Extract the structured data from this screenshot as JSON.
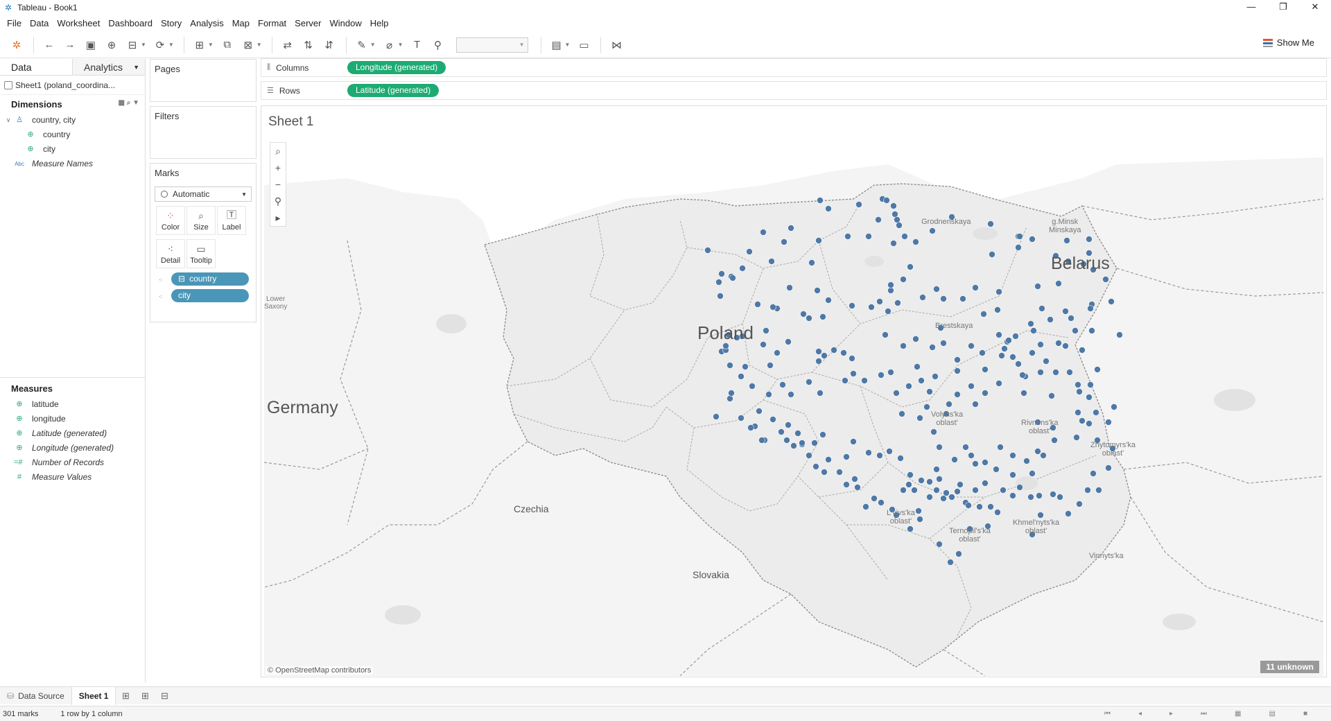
{
  "window": {
    "title": "Tableau - Book1",
    "controls": [
      "—",
      "❐",
      "✕"
    ]
  },
  "menu": [
    "File",
    "Data",
    "Worksheet",
    "Dashboard",
    "Story",
    "Analysis",
    "Map",
    "Format",
    "Server",
    "Window",
    "Help"
  ],
  "toolbar": {
    "show_me_label": "Show Me"
  },
  "data_pane": {
    "tab_data": "Data",
    "tab_analytics": "Analytics",
    "datasource": "Sheet1 (poland_coordina...",
    "dimensions_title": "Dimensions",
    "dimensions": [
      {
        "label": "country, city",
        "icon": "hierarchy-icon"
      },
      {
        "label": "country",
        "icon": "globe-icon"
      },
      {
        "label": "city",
        "icon": "globe-icon"
      },
      {
        "label": "Measure Names",
        "icon": "abc-icon"
      }
    ],
    "measures_title": "Measures",
    "measures": [
      {
        "label": "latitude",
        "icon": "globe-icon"
      },
      {
        "label": "longitude",
        "icon": "globe-icon"
      },
      {
        "label": "Latitude (generated)",
        "icon": "globe-icon"
      },
      {
        "label": "Longitude (generated)",
        "icon": "globe-icon"
      },
      {
        "label": "Number of Records",
        "icon": "hash-icon"
      },
      {
        "label": "Measure Values",
        "icon": "hash-icon"
      }
    ]
  },
  "cards": {
    "pages": "Pages",
    "filters": "Filters",
    "marks": "Marks",
    "marks_type": "Automatic",
    "buttons": [
      "Color",
      "Size",
      "Label",
      "Detail",
      "Tooltip"
    ],
    "pills": [
      "country",
      "city"
    ]
  },
  "shelves": {
    "columns_label": "Columns",
    "columns_pill": "Longitude (generated)",
    "rows_label": "Rows",
    "rows_pill": "Latitude (generated)"
  },
  "sheet": {
    "title": "Sheet 1",
    "attribution": "© OpenStreetMap contributors",
    "unknown_badge": "11 unknown",
    "map_labels": {
      "poland": "Poland",
      "germany": "Germany",
      "belarus": "Belarus",
      "czechia": "Czechia",
      "slovakia": "Slovakia",
      "lower_saxony": "Lower\nSaxony",
      "grodnenskaya": "Grodnenskaya",
      "minsk": "g.Minsk\nMinskaya",
      "brestskaya": "Brestskaya",
      "volyn": "Volyns'ka\noblast'",
      "rivne": "Rivnens'ka\noblast'",
      "zhytomyr": "Zhytomyrs'ka\noblast'",
      "lviv": "L'vivs'ka\noblast'",
      "ternopil": "Ternopil's'ka\noblast'",
      "khmelnytsky": "Khmel'nyts'ka\noblast'",
      "vinnytsia": "Vinnyts'ka"
    },
    "mark_color": "#4e79a7"
  },
  "tabs": {
    "data_source": "Data Source",
    "sheet": "Sheet 1"
  },
  "status": {
    "marks": "301 marks",
    "layout": "1 row by 1 column"
  }
}
